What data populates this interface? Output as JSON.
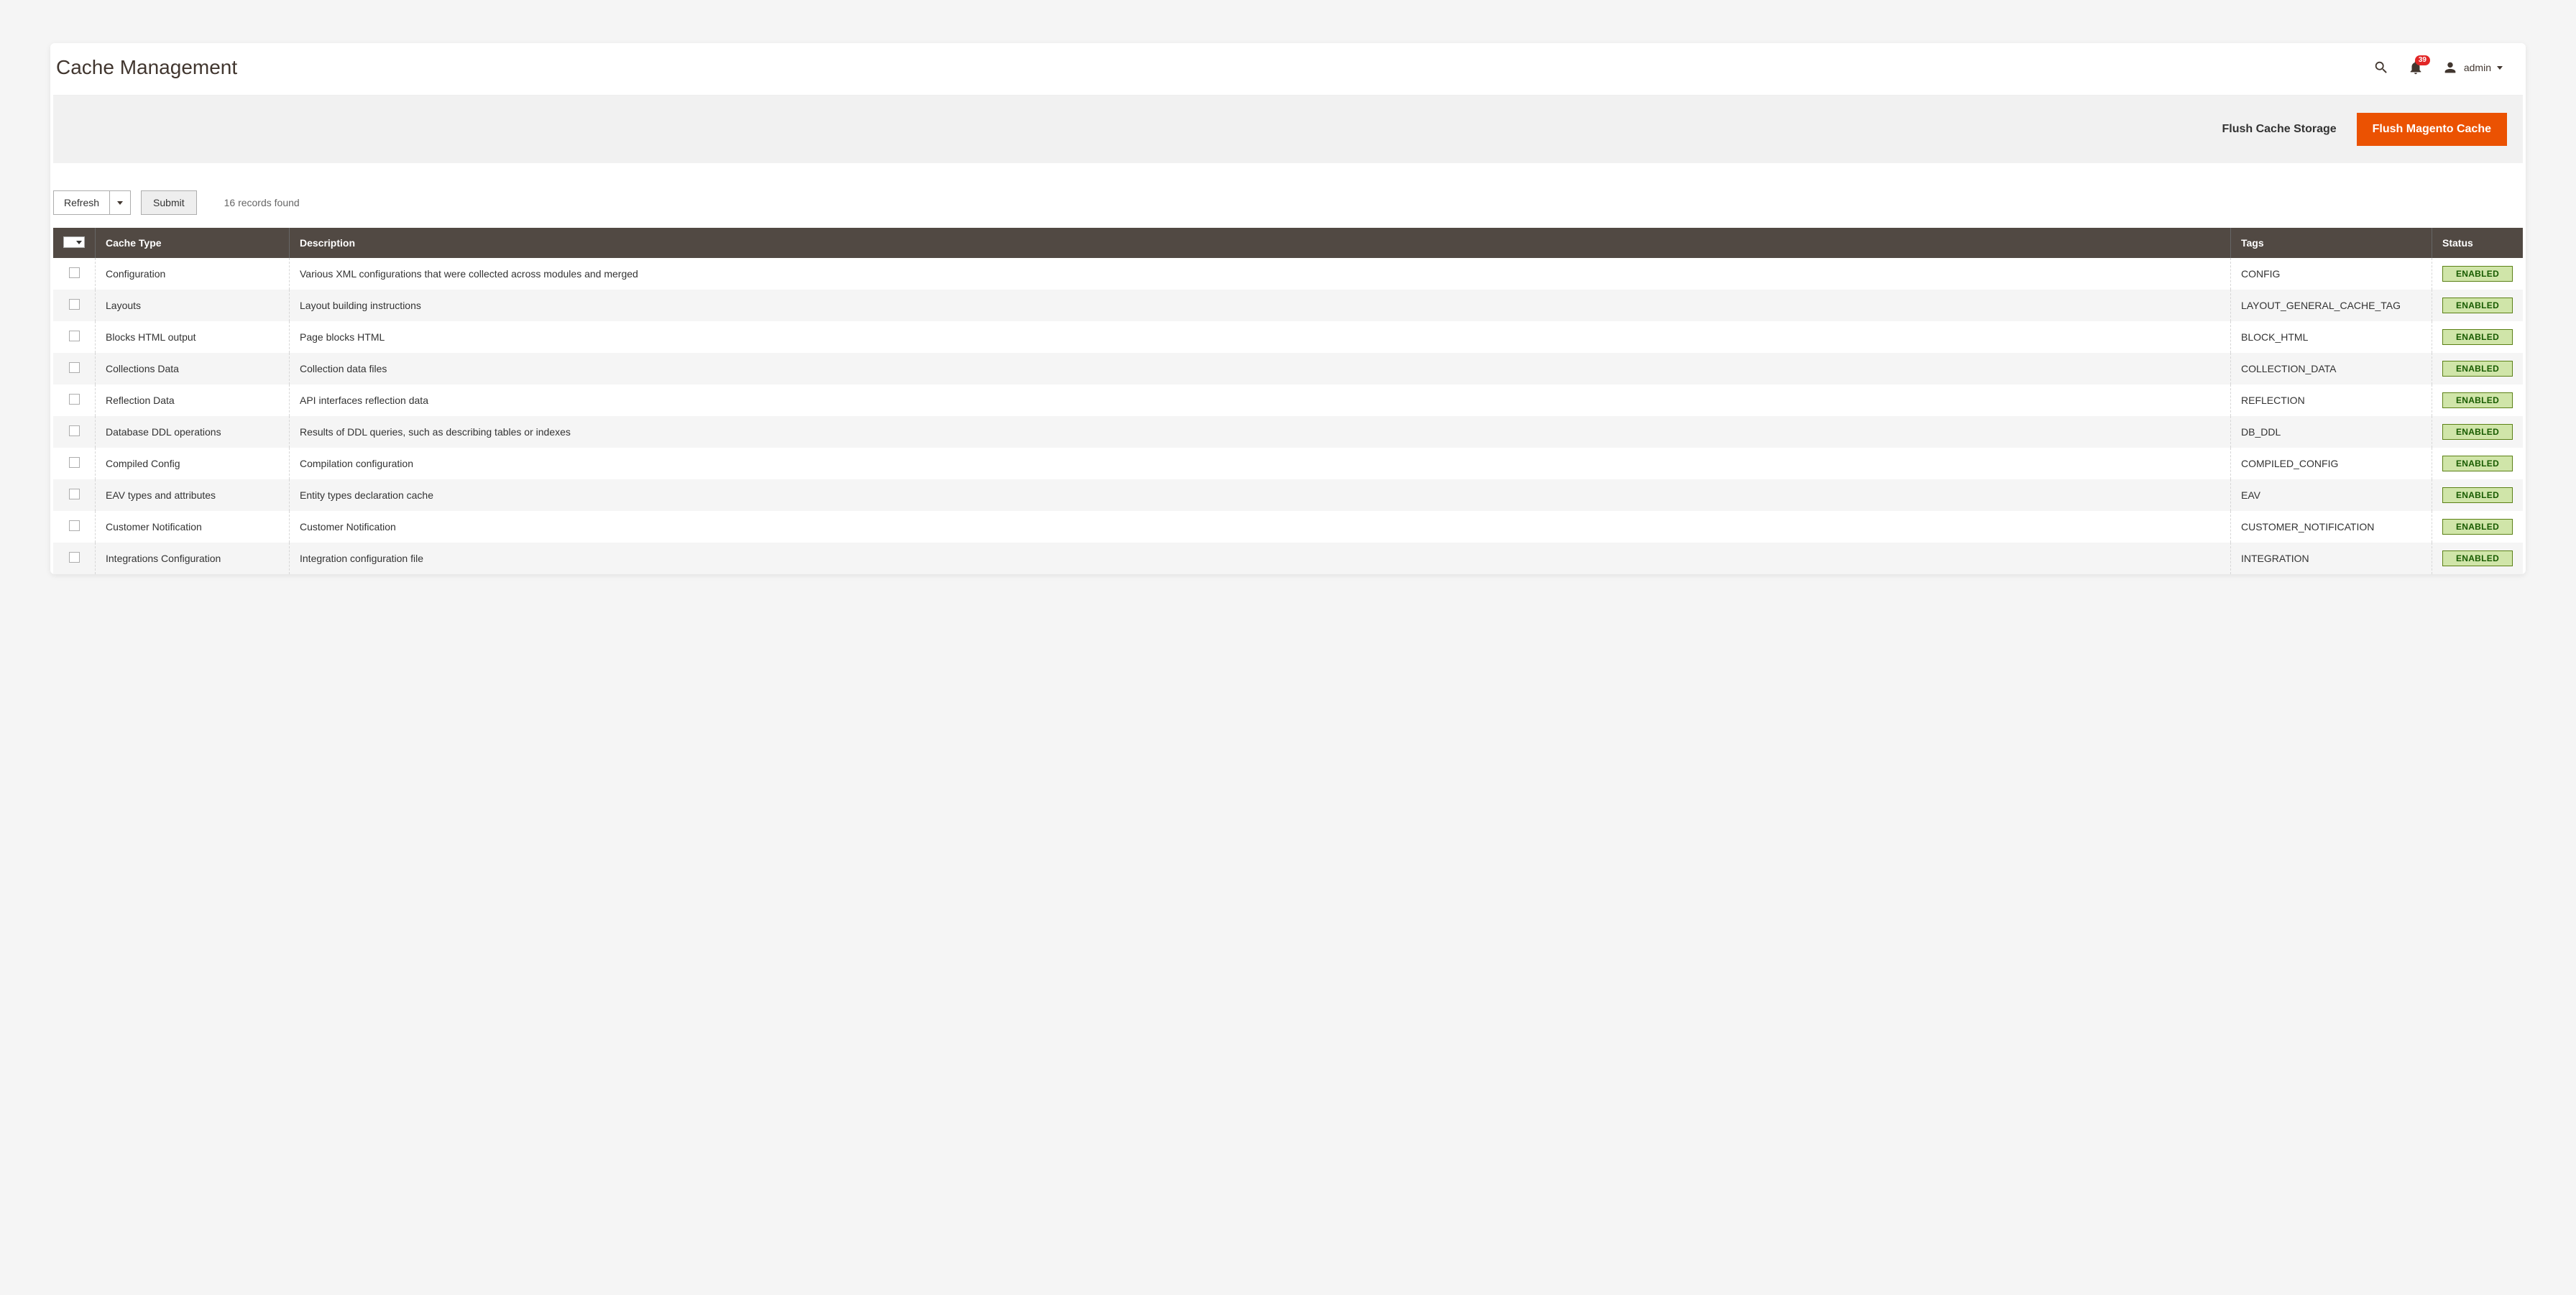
{
  "header": {
    "title": "Cache Management",
    "notification_count": "39",
    "user_name": "admin"
  },
  "action_bar": {
    "flush_storage": "Flush Cache Storage",
    "flush_magento": "Flush Magento Cache"
  },
  "toolbar": {
    "refresh": "Refresh",
    "submit": "Submit",
    "records_found": "16 records found"
  },
  "table": {
    "headers": {
      "cache_type": "Cache Type",
      "description": "Description",
      "tags": "Tags",
      "status": "Status"
    },
    "rows": [
      {
        "type": "Configuration",
        "desc": "Various XML configurations that were collected across modules and merged",
        "tags": "CONFIG",
        "status": "ENABLED"
      },
      {
        "type": "Layouts",
        "desc": "Layout building instructions",
        "tags": "LAYOUT_GENERAL_CACHE_TAG",
        "status": "ENABLED"
      },
      {
        "type": "Blocks HTML output",
        "desc": "Page blocks HTML",
        "tags": "BLOCK_HTML",
        "status": "ENABLED"
      },
      {
        "type": "Collections Data",
        "desc": "Collection data files",
        "tags": "COLLECTION_DATA",
        "status": "ENABLED"
      },
      {
        "type": "Reflection Data",
        "desc": "API interfaces reflection data",
        "tags": "REFLECTION",
        "status": "ENABLED"
      },
      {
        "type": "Database DDL operations",
        "desc": "Results of DDL queries, such as describing tables or indexes",
        "tags": "DB_DDL",
        "status": "ENABLED"
      },
      {
        "type": "Compiled Config",
        "desc": "Compilation configuration",
        "tags": "COMPILED_CONFIG",
        "status": "ENABLED"
      },
      {
        "type": "EAV types and attributes",
        "desc": "Entity types declaration cache",
        "tags": "EAV",
        "status": "ENABLED"
      },
      {
        "type": "Customer Notification",
        "desc": "Customer Notification",
        "tags": "CUSTOMER_NOTIFICATION",
        "status": "ENABLED"
      },
      {
        "type": "Integrations Configuration",
        "desc": "Integration configuration file",
        "tags": "INTEGRATION",
        "status": "ENABLED"
      }
    ]
  }
}
